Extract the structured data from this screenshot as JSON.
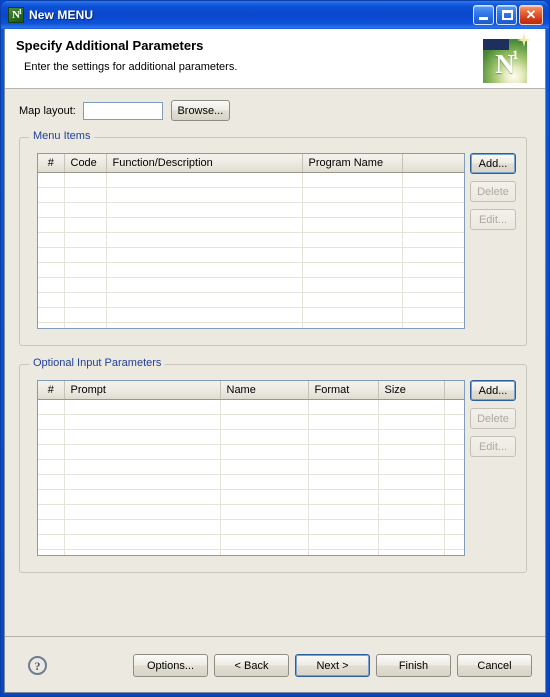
{
  "window": {
    "title": "New MENU",
    "icon": "app-n1-icon",
    "controls": {
      "minimize": "Minimize",
      "maximize": "Maximize",
      "close": "Close"
    }
  },
  "header": {
    "title": "Specify Additional Parameters",
    "subtitle": "Enter the settings for additional parameters.",
    "logo_letter": "N",
    "logo_sup": "1"
  },
  "form": {
    "map_layout_label": "Map layout:",
    "map_layout_value": "",
    "map_layout_placeholder": "",
    "browse_label": "Browse..."
  },
  "menu_items": {
    "group_title": "Menu Items",
    "columns": [
      "#",
      "Code",
      "Function/Description",
      "Program Name",
      ""
    ],
    "rows": [],
    "empty_row_count": 11,
    "buttons": {
      "add": "Add...",
      "delete": "Delete",
      "edit": "Edit..."
    },
    "button_states": {
      "add": "default",
      "delete": "disabled",
      "edit": "disabled"
    }
  },
  "optional_params": {
    "group_title": "Optional Input Parameters",
    "columns": [
      "#",
      "Prompt",
      "Name",
      "Format",
      "Size",
      ""
    ],
    "rows": [],
    "empty_row_count": 11,
    "buttons": {
      "add": "Add...",
      "delete": "Delete",
      "edit": "Edit..."
    },
    "button_states": {
      "add": "default",
      "delete": "disabled",
      "edit": "disabled"
    }
  },
  "footer": {
    "help_glyph": "?",
    "buttons": [
      {
        "label": "Options...",
        "state": "normal"
      },
      {
        "label": "< Back",
        "state": "normal"
      },
      {
        "label": "Next >",
        "state": "default"
      },
      {
        "label": "Finish",
        "state": "normal"
      },
      {
        "label": "Cancel",
        "state": "normal"
      }
    ]
  },
  "colors": {
    "titlebar_blue": "#0a4fd0",
    "dialog_bg": "#ece9e0",
    "group_title": "#22409a",
    "table_border": "#7f9db9",
    "close_red": "#cf3716"
  }
}
